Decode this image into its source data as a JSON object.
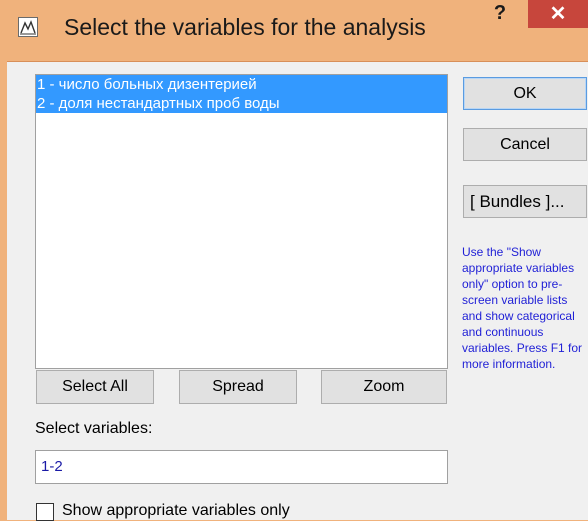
{
  "window": {
    "title": "Select the variables for the analysis",
    "app_icon": "statistics-app-icon",
    "help_glyph": "?",
    "close_glyph": "✕",
    "frame_color": "#f0b27c",
    "close_color": "#c7463c"
  },
  "variables_list": {
    "items": [
      {
        "label": "1 - число больных дизентерией",
        "selected": true
      },
      {
        "label": "2 - доля нестандартных проб воды",
        "selected": true
      }
    ],
    "selection_color": "#3399ff"
  },
  "buttons": {
    "ok": "OK",
    "cancel": "Cancel",
    "bundles": "[ Bundles ]...",
    "select_all": "Select All",
    "spread": "Spread",
    "zoom": "Zoom"
  },
  "help_text": "Use the \"Show appropriate variables only\" option to pre-screen variable lists and show categorical and continuous variables. Press F1 for more information.",
  "help_text_color": "#1f1fd6",
  "select_variables": {
    "label": "Select variables:",
    "value": "1-2"
  },
  "show_appropriate": {
    "label": "Show appropriate variables only",
    "checked": false
  }
}
